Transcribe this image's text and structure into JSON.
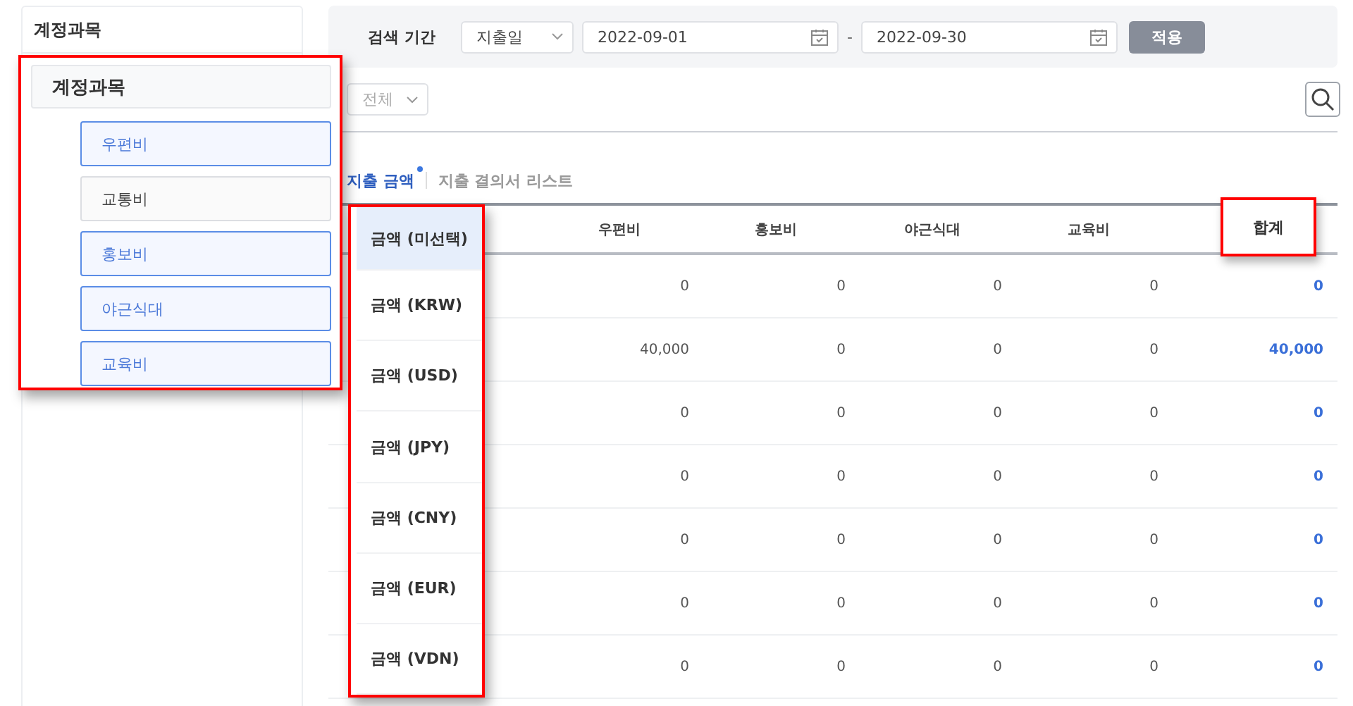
{
  "sidebar": {
    "title": "계정과목"
  },
  "account_callout": {
    "title": "계정과목",
    "items": [
      {
        "label": "우편비",
        "selected": true
      },
      {
        "label": "교통비",
        "selected": false
      },
      {
        "label": "홍보비",
        "selected": true
      },
      {
        "label": "야근식대",
        "selected": true
      },
      {
        "label": "교육비",
        "selected": true
      }
    ]
  },
  "filter": {
    "label": "검색 기간",
    "date_type": {
      "value": "지출일"
    },
    "start_date": "2022-09-01",
    "separator": "-",
    "end_date": "2022-09-30",
    "apply_button": "적용"
  },
  "toolbar": {
    "scope_select": {
      "value": "전체"
    }
  },
  "tabs": [
    {
      "label": "지출 금액",
      "selected": true,
      "dot": true
    },
    {
      "label": "지출 결의서 리스트",
      "selected": false,
      "dot": false
    }
  ],
  "table": {
    "columns": [
      {
        "label": "우편비",
        "kind": "amount"
      },
      {
        "label": "홍보비",
        "kind": "amount"
      },
      {
        "label": "야근식대",
        "kind": "amount"
      },
      {
        "label": "교육비",
        "kind": "amount"
      },
      {
        "label": "합계",
        "kind": "total",
        "highlighted": true
      }
    ],
    "rows": [
      [
        "0",
        "0",
        "0",
        "0",
        "0"
      ],
      [
        "40,000",
        "0",
        "0",
        "0",
        "40,000"
      ],
      [
        "0",
        "0",
        "0",
        "0",
        "0"
      ],
      [
        "0",
        "0",
        "0",
        "0",
        "0"
      ],
      [
        "0",
        "0",
        "0",
        "0",
        "0"
      ],
      [
        "0",
        "0",
        "0",
        "0",
        "0"
      ],
      [
        "0",
        "0",
        "0",
        "0",
        "0"
      ]
    ]
  },
  "currency_dropdown": {
    "options": [
      {
        "label": "금액 (미선택)",
        "selected": true
      },
      {
        "label": "금액 (KRW)",
        "selected": false
      },
      {
        "label": "금액 (USD)",
        "selected": false
      },
      {
        "label": "금액 (JPY)",
        "selected": false
      },
      {
        "label": "금액 (CNY)",
        "selected": false
      },
      {
        "label": "금액 (EUR)",
        "selected": false
      },
      {
        "label": "금액 (VDN)",
        "selected": false
      }
    ]
  }
}
